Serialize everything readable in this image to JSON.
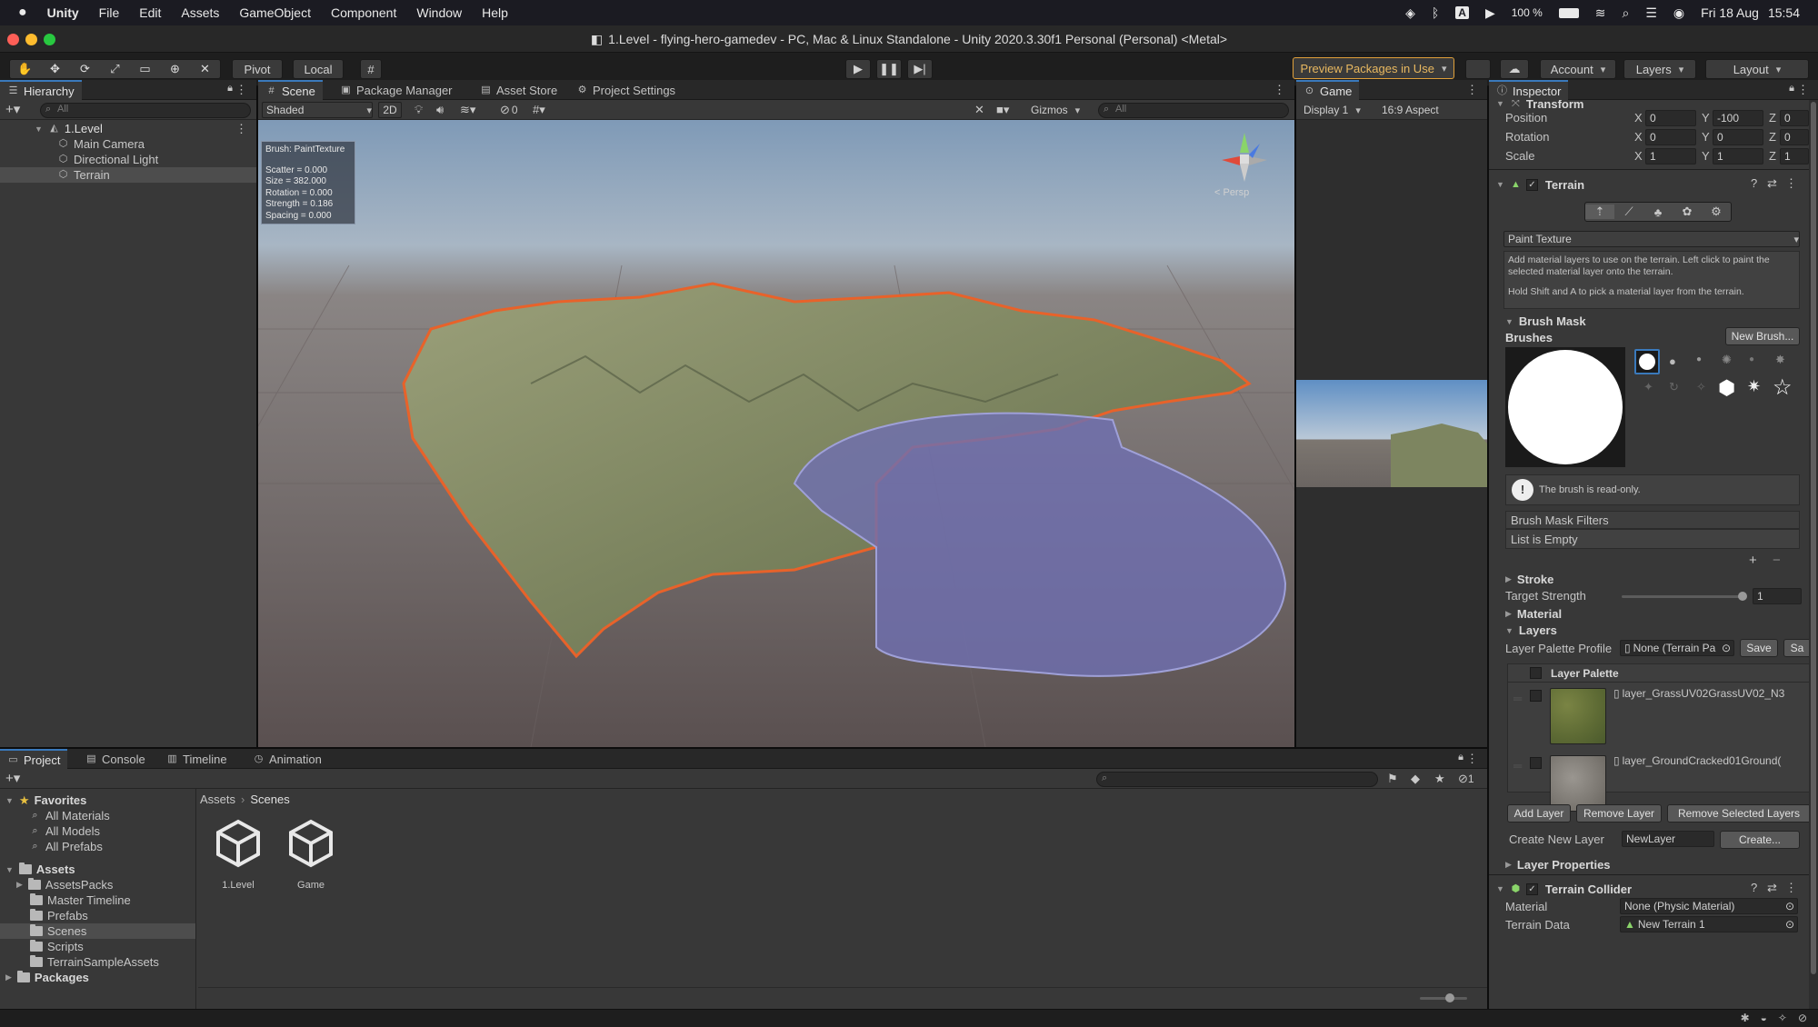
{
  "menubar": {
    "app": "Unity",
    "items": [
      "File",
      "Edit",
      "Assets",
      "GameObject",
      "Component",
      "Window",
      "Help"
    ],
    "battery": "100 %",
    "date": "Fri 18 Aug",
    "time": "15:54",
    "input_letter": "A"
  },
  "title": "1.Level - flying-hero-gamedev - PC, Mac & Linux Standalone - Unity 2020.3.30f1 Personal (Personal) <Metal>",
  "toolbar": {
    "pivot": "Pivot",
    "local": "Local",
    "preview_packages": "Preview Packages in Use",
    "account": "Account",
    "layers": "Layers",
    "layout": "Layout"
  },
  "hierarchy": {
    "tab": "Hierarchy",
    "search_placeholder": "All",
    "scene": "1.Level",
    "items": [
      "Main Camera",
      "Directional Light",
      "Terrain"
    ],
    "selected": "Terrain"
  },
  "scene": {
    "tabs": [
      "Scene",
      "Package Manager",
      "Asset Store",
      "Project Settings"
    ],
    "shading": "Shaded",
    "mode_2d": "2D",
    "gizmos": "Gizmos",
    "search_placeholder": "All",
    "fx_count": "0",
    "persp": "< Persp",
    "brush_info": {
      "title": "Brush: PaintTexture",
      "lines": [
        "Scatter = 0.000",
        "Size = 382.000",
        "Rotation = 0.000",
        "Strength = 0.186",
        "Spacing = 0.000"
      ]
    }
  },
  "game": {
    "tab": "Game",
    "display": "Display 1",
    "aspect": "16:9 Aspect"
  },
  "inspector": {
    "tab": "Inspector",
    "transform_title": "Transform",
    "position": {
      "label": "Position",
      "x": "0",
      "y": "-100",
      "z": "0"
    },
    "rotation": {
      "label": "Rotation",
      "x": "0",
      "y": "0",
      "z": "0"
    },
    "scale": {
      "label": "Scale",
      "x": "1",
      "y": "1",
      "z": "1"
    },
    "terrain_title": "Terrain",
    "tool": "Paint Texture",
    "help1": "Add material layers to use on the terrain. Left click to paint the selected material layer onto the terrain.",
    "help2": "Hold Shift and A to pick a material layer from the terrain.",
    "brush_mask": "Brush Mask",
    "brushes": "Brushes",
    "new_brush": "New Brush...",
    "readonly": "The brush is read-only.",
    "mask_filters": "Brush Mask Filters",
    "list_empty": "List is Empty",
    "stroke": "Stroke",
    "target_strength": "Target Strength",
    "target_strength_value": "1",
    "material": "Material",
    "layers": "Layers",
    "palette_profile": "Layer Palette Profile",
    "palette_none": "None (Terrain Pa",
    "save": "Save",
    "save_as": "Sa",
    "layer_palette": "Layer Palette",
    "layer_items": [
      "layer_GrassUV02GrassUV02_N3",
      "layer_GroundCracked01Ground("
    ],
    "add_layer": "Add Layer",
    "remove_layer": "Remove Layer",
    "remove_selected": "Remove Selected Layers",
    "create_new_layer": "Create New Layer",
    "new_layer_value": "NewLayer",
    "create": "Create...",
    "layer_properties": "Layer Properties",
    "collider_title": "Terrain Collider",
    "collider_material_label": "Material",
    "collider_material": "None (Physic Material)",
    "terrain_data_label": "Terrain Data",
    "terrain_data": "New Terrain 1"
  },
  "project": {
    "tabs": [
      "Project",
      "Console",
      "Timeline",
      "Animation"
    ],
    "favorites": "Favorites",
    "fav_items": [
      "All Materials",
      "All Models",
      "All Prefabs"
    ],
    "assets": "Assets",
    "folders": [
      "AssetsPacks",
      "Master Timeline",
      "Prefabs",
      "Scenes",
      "Scripts",
      "TerrainSampleAssets"
    ],
    "selected_folder": "Scenes",
    "packages": "Packages",
    "breadcrumb": [
      "Assets",
      "Scenes"
    ],
    "files": [
      "1.Level",
      "Game"
    ],
    "hidden_count": "1"
  },
  "colors": {
    "accent": "#3a79bb",
    "selection_outline": "#e8622a",
    "water": "#6f6fb0",
    "preview_border": "#e0a03a"
  }
}
